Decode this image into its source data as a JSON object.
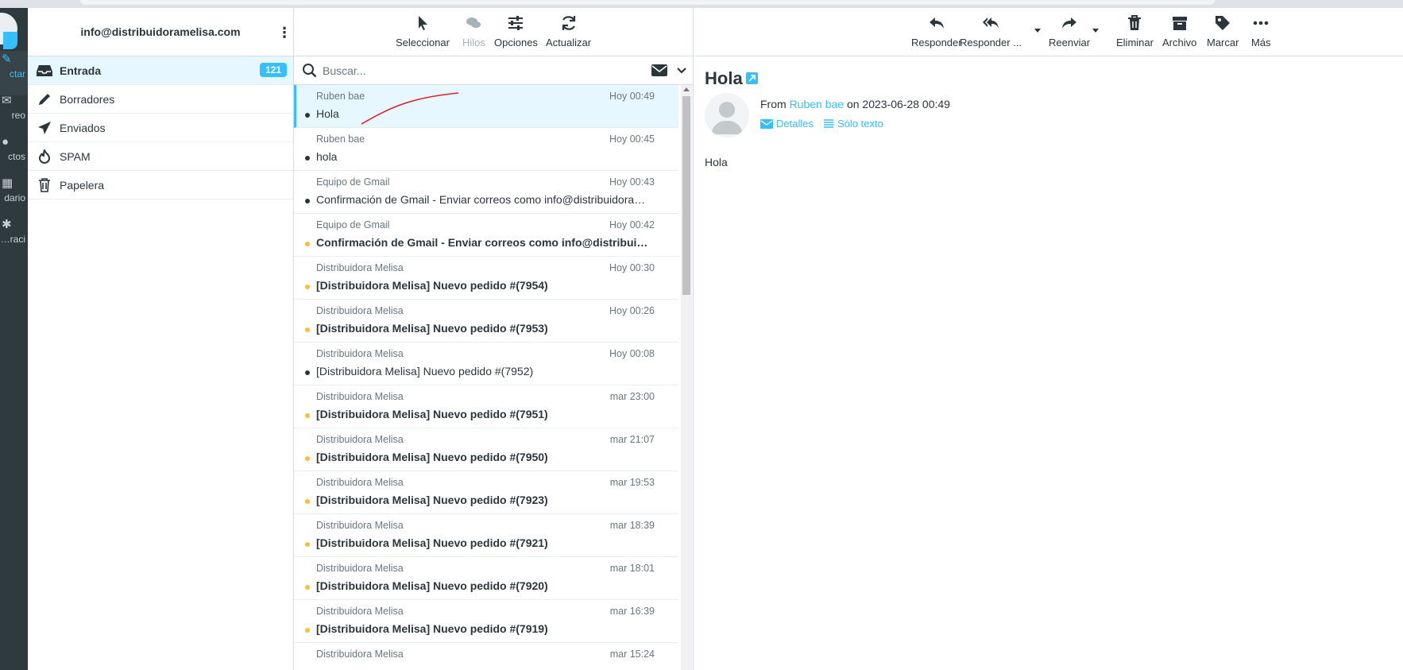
{
  "rail": {
    "items": [
      {
        "label": "ctar",
        "icon": "pencil-icon",
        "active": true
      },
      {
        "label": "reo",
        "icon": "envelope-icon",
        "active": false
      },
      {
        "label": "ctos",
        "icon": "contacts-icon",
        "active": false
      },
      {
        "label": "dario",
        "icon": "calendar-icon",
        "active": false
      },
      {
        "label": "raci…",
        "icon": "gear-icon",
        "active": false
      }
    ]
  },
  "folders": {
    "account": "info@distribuidoramelisa.com",
    "items": [
      {
        "label": "Entrada",
        "icon": "inbox-icon",
        "count": "121",
        "active": true
      },
      {
        "label": "Borradores",
        "icon": "pencil-icon"
      },
      {
        "label": "Enviados",
        "icon": "paper-plane-icon"
      },
      {
        "label": "SPAM",
        "icon": "fire-icon"
      },
      {
        "label": "Papelera",
        "icon": "trash-icon"
      }
    ]
  },
  "list_toolbar": {
    "select": "Seleccionar",
    "threads": "Hilos",
    "options": "Opciones",
    "refresh": "Actualizar"
  },
  "search": {
    "placeholder": "Buscar..."
  },
  "messages": [
    {
      "from": "Ruben bae",
      "date": "Hoy 00:49",
      "subject": "Hola",
      "unread": false,
      "selected": true
    },
    {
      "from": "Ruben bae",
      "date": "Hoy 00:45",
      "subject": "hola",
      "unread": false
    },
    {
      "from": "Equipo de Gmail",
      "date": "Hoy 00:43",
      "subject": "Confirmación de Gmail - Enviar correos como info@distribuidoramelisa.com",
      "unread": false
    },
    {
      "from": "Equipo de Gmail",
      "date": "Hoy 00:42",
      "subject": "Confirmación de Gmail - Enviar correos como info@distribuidoramelisa.com",
      "unread": true
    },
    {
      "from": "Distribuidora Melisa",
      "date": "Hoy 00:30",
      "subject": "[Distribuidora Melisa] Nuevo pedido #(7954)",
      "unread": true
    },
    {
      "from": "Distribuidora Melisa",
      "date": "Hoy 00:26",
      "subject": "[Distribuidora Melisa] Nuevo pedido #(7953)",
      "unread": true
    },
    {
      "from": "Distribuidora Melisa",
      "date": "Hoy 00:08",
      "subject": "[Distribuidora Melisa] Nuevo pedido #(7952)",
      "unread": false
    },
    {
      "from": "Distribuidora Melisa",
      "date": "mar 23:00",
      "subject": "[Distribuidora Melisa] Nuevo pedido #(7951)",
      "unread": true
    },
    {
      "from": "Distribuidora Melisa",
      "date": "mar 21:07",
      "subject": "[Distribuidora Melisa] Nuevo pedido #(7950)",
      "unread": true
    },
    {
      "from": "Distribuidora Melisa",
      "date": "mar 19:53",
      "subject": "[Distribuidora Melisa] Nuevo pedido #(7923)",
      "unread": true
    },
    {
      "from": "Distribuidora Melisa",
      "date": "mar 18:39",
      "subject": "[Distribuidora Melisa] Nuevo pedido #(7921)",
      "unread": true
    },
    {
      "from": "Distribuidora Melisa",
      "date": "mar 18:01",
      "subject": "[Distribuidora Melisa] Nuevo pedido #(7920)",
      "unread": true
    },
    {
      "from": "Distribuidora Melisa",
      "date": "mar 16:39",
      "subject": "[Distribuidora Melisa] Nuevo pedido #(7919)",
      "unread": true
    },
    {
      "from": "Distribuidora Melisa",
      "date": "mar 15:24",
      "subject": "",
      "unread": true
    }
  ],
  "reader_toolbar": {
    "reply": "Responder",
    "reply_all": "Responder ...",
    "forward": "Reenviar",
    "delete": "Eliminar",
    "archive": "Archivo",
    "mark": "Marcar",
    "more": "Más"
  },
  "reader": {
    "subject": "Hola",
    "from_prefix": "From",
    "from_name": "Ruben bae",
    "on_text": "on 2023-06-28 00:49",
    "details": "Detalles",
    "plain_text": "Sólo texto",
    "body": "Hola"
  },
  "colors": {
    "accent": "#37beff",
    "unread_dot": "#ffc02e",
    "rail": "#2f3a3f",
    "annotation": "#e0202a"
  }
}
